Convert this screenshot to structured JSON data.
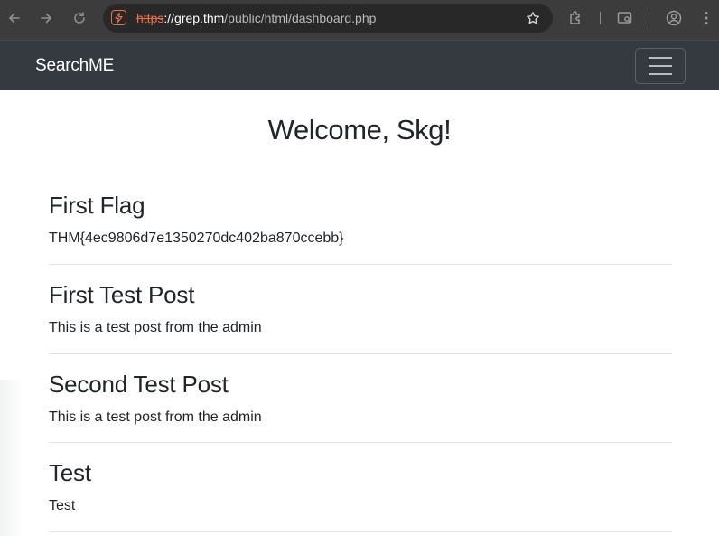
{
  "browser": {
    "url_scheme": "https",
    "url_host": "://grep.thm",
    "url_path": "/public/html/dashboard.php"
  },
  "navbar": {
    "brand": "SearchME"
  },
  "welcome": "Welcome, Skg!",
  "posts": [
    {
      "title": "First Flag",
      "body": "THM{4ec9806d7e1350270dc402ba870ccebb}"
    },
    {
      "title": "First Test Post",
      "body": "This is a test post from the admin"
    },
    {
      "title": "Second Test Post",
      "body": "This is a test post from the admin"
    },
    {
      "title": "Test",
      "body": "Test"
    }
  ],
  "colors": {
    "browser_chrome": "#3c3c3c",
    "navbar_bg": "#343a40",
    "insecure_scheme": "#e8704f"
  }
}
